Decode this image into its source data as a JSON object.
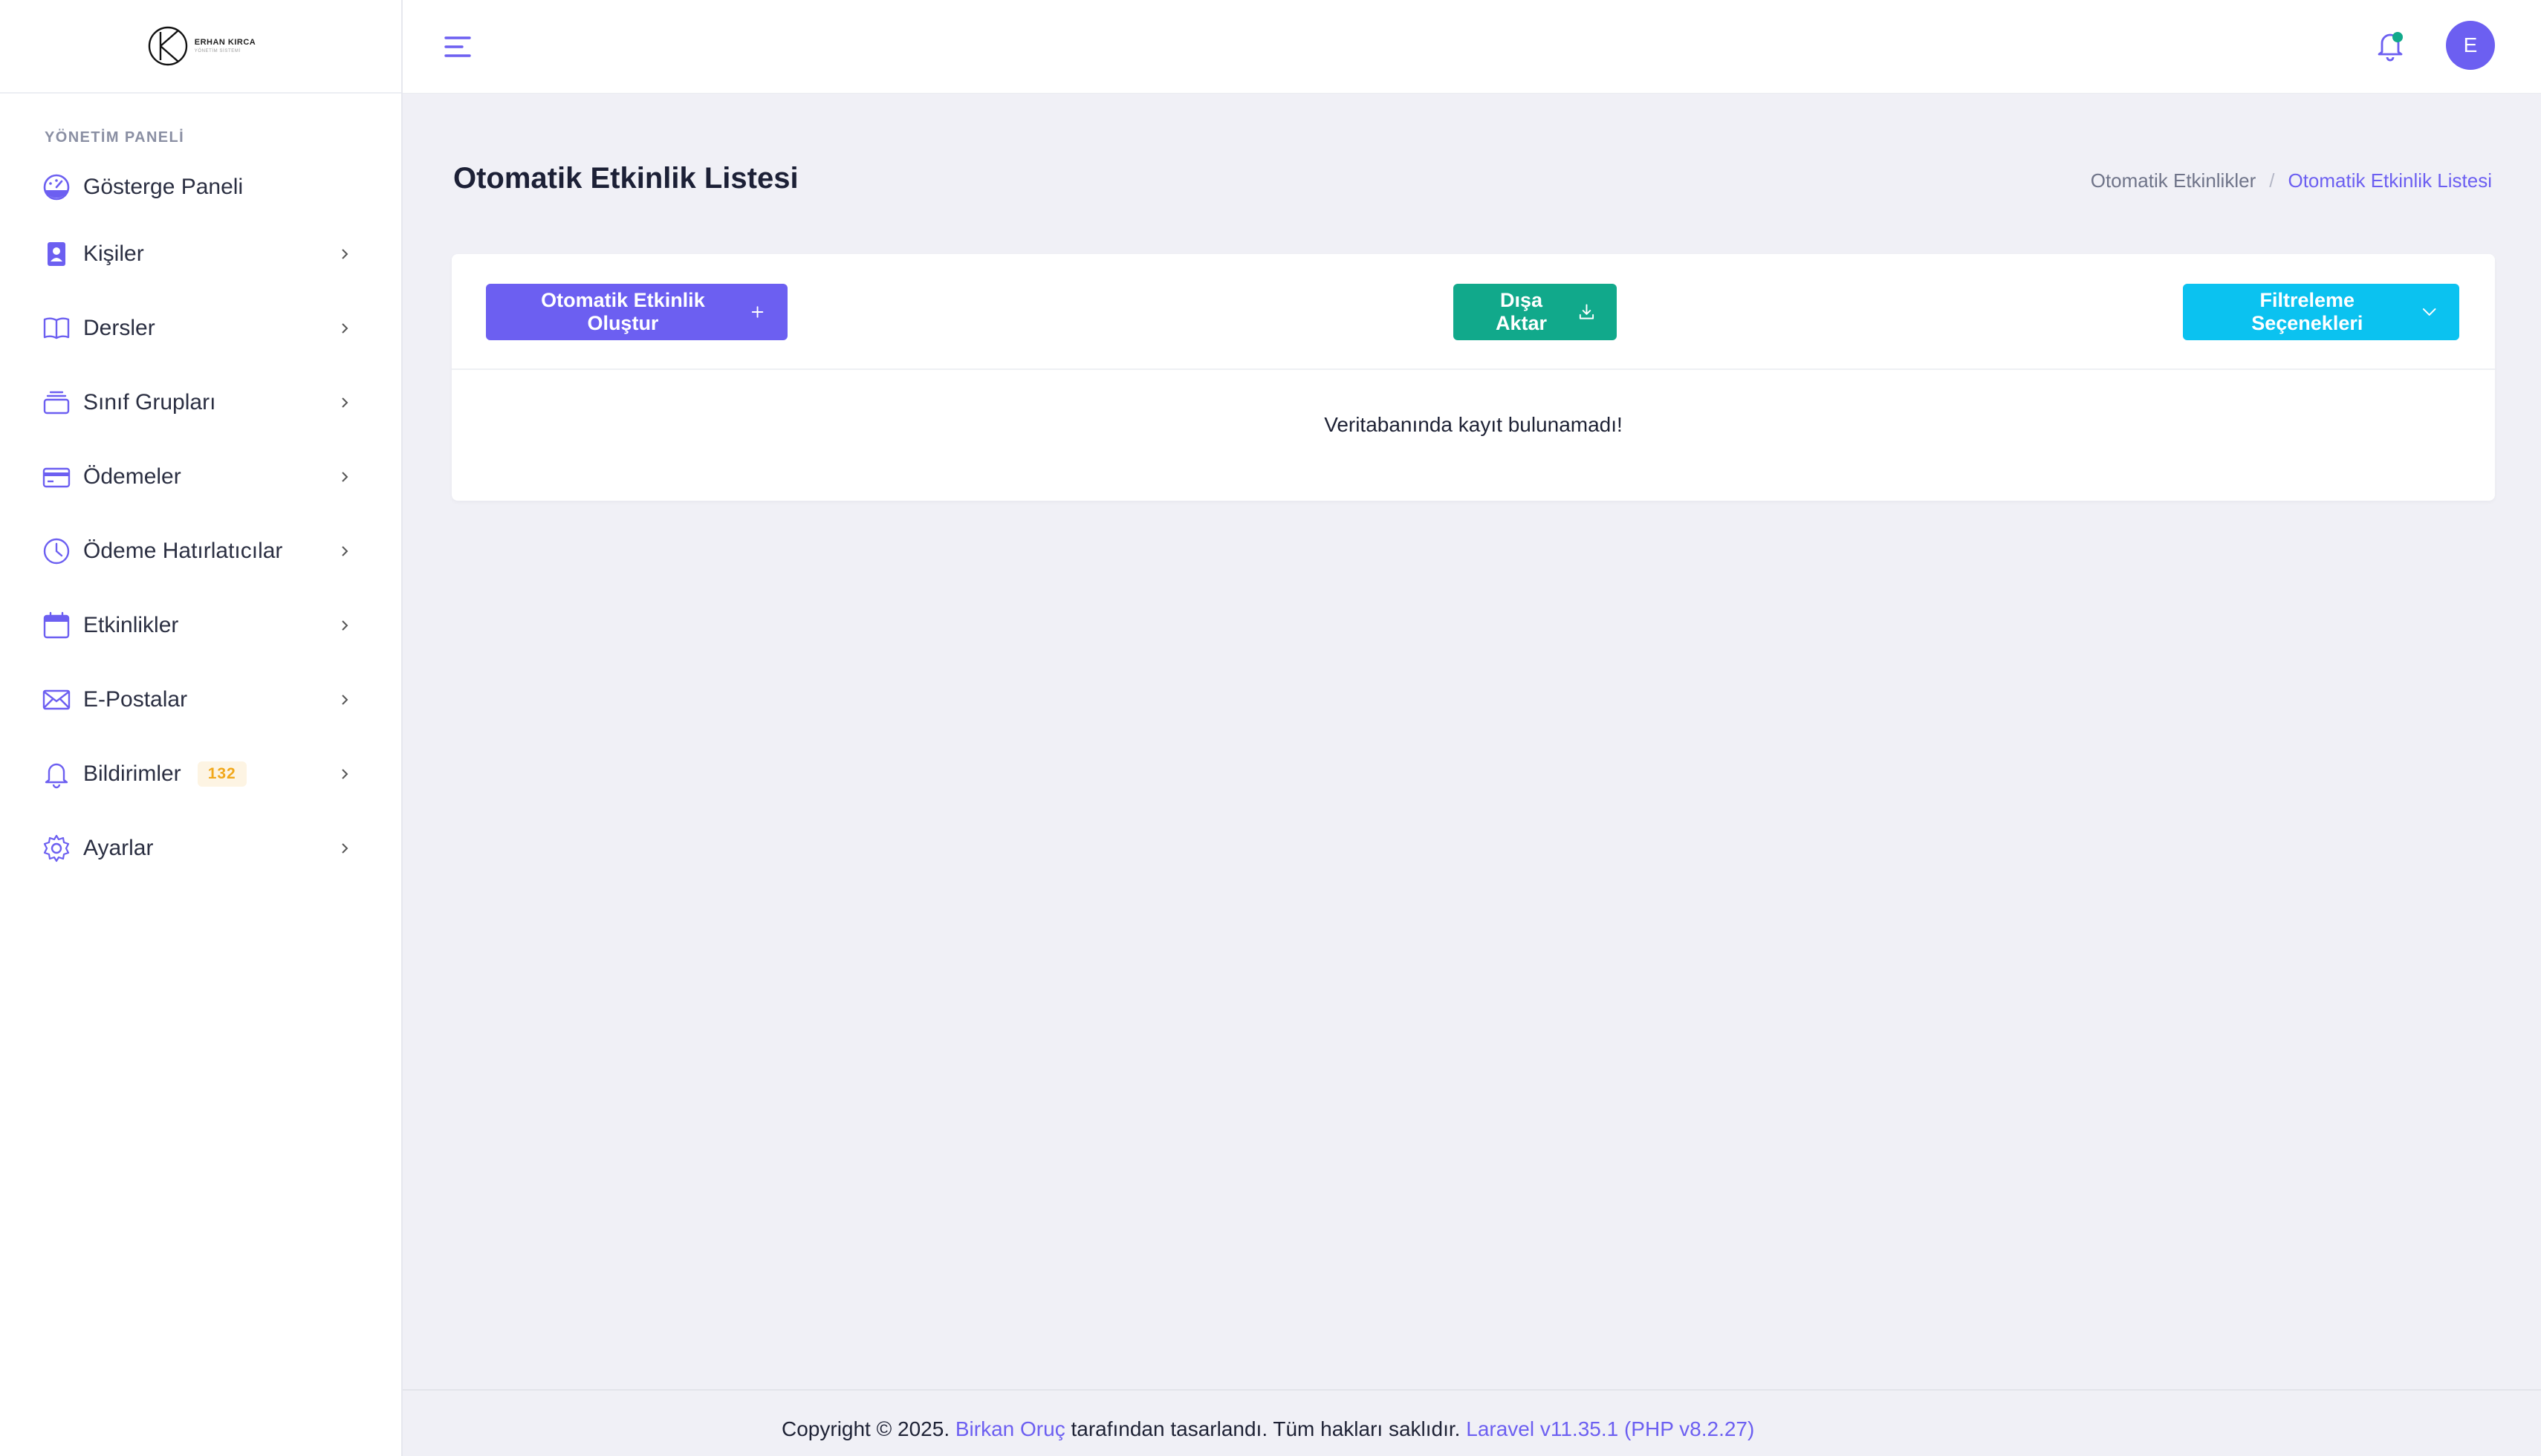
{
  "logo": {
    "name": "ERHAN KIRCA",
    "subtitle": "YÖNETİM SİSTEMİ"
  },
  "sidebar": {
    "section_title": "YÖNETİM PANELİ",
    "items": [
      {
        "label": "Gösterge Paneli",
        "icon": "dashboard-icon"
      },
      {
        "label": "Kişiler",
        "icon": "contacts-icon"
      },
      {
        "label": "Dersler",
        "icon": "book-icon"
      },
      {
        "label": "Sınıf Grupları",
        "icon": "layers-icon"
      },
      {
        "label": "Ödemeler",
        "icon": "credit-card-icon"
      },
      {
        "label": "Ödeme Hatırlatıcılar",
        "icon": "clock-icon"
      },
      {
        "label": "Etkinlikler",
        "icon": "calendar-icon"
      },
      {
        "label": "E-Postalar",
        "icon": "mail-icon"
      },
      {
        "label": "Bildirimler",
        "icon": "bell-icon",
        "badge": "132"
      },
      {
        "label": "Ayarlar",
        "icon": "gear-icon"
      }
    ]
  },
  "topbar": {
    "avatar_initial": "E"
  },
  "page": {
    "title": "Otomatik Etkinlik Listesi",
    "breadcrumb": [
      "Otomatik Etkinlikler",
      "Otomatik Etkinlik Listesi"
    ]
  },
  "card": {
    "create_label": "Otomatik Etkinlik Oluştur",
    "export_label": "Dışa Aktar",
    "filter_label": "Filtreleme Seçenekleri",
    "empty_message": "Veritabanında kayıt bulunamadı!"
  },
  "footer": {
    "prefix": "Copyright © 2025.",
    "author": "Birkan Oruç",
    "middle": "tarafından tasarlandı. Tüm hakları saklıdır.",
    "version": "Laravel v11.35.1 (PHP v8.2.27)"
  },
  "colors": {
    "accent": "#6c5ff1",
    "success": "#11a98b",
    "info": "#0bc2f0",
    "badge_text": "#f1a81b",
    "badge_bg": "#fdf4e3"
  }
}
